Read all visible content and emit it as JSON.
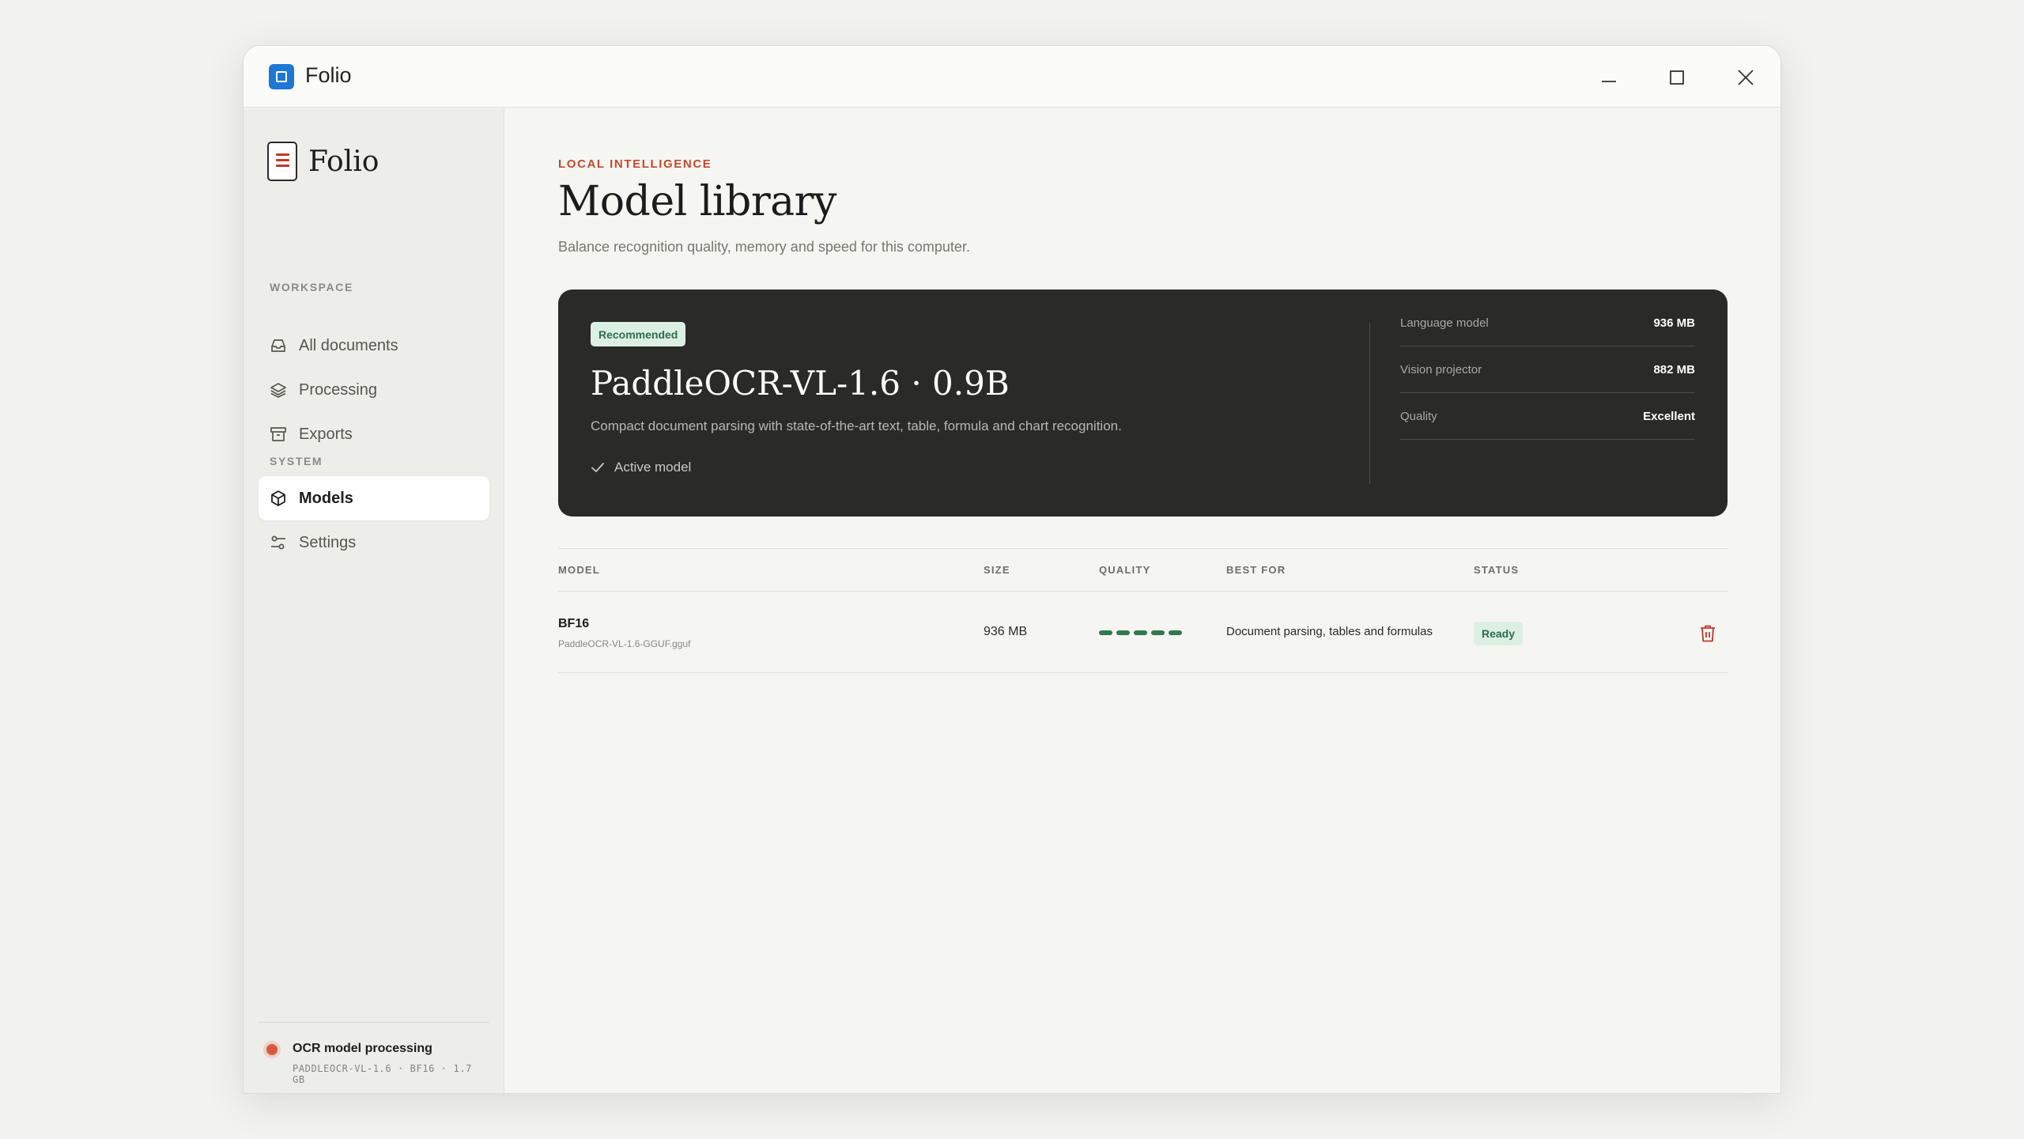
{
  "window": {
    "title": "Folio",
    "controls": [
      "minimize",
      "maximize",
      "close"
    ]
  },
  "sidebar": {
    "brand": "Folio",
    "workspace_label": "WORKSPACE",
    "workspace_items": [
      {
        "label": "All documents",
        "icon": "inbox-icon"
      },
      {
        "label": "Processing",
        "icon": "layers-icon"
      },
      {
        "label": "Exports",
        "icon": "archive-icon"
      }
    ],
    "system_label": "SYSTEM",
    "system_items": [
      {
        "label": "Models",
        "icon": "cube-icon",
        "active": true
      },
      {
        "label": "Settings",
        "icon": "sliders-icon"
      }
    ],
    "footer": {
      "title": "OCR model processing",
      "subtitle": "PADDLEOCR-VL-1.6 · BF16 · 1.7 GB"
    }
  },
  "main": {
    "eyebrow": "LOCAL INTELLIGENCE",
    "title": "Model library",
    "subtitle": "Balance recognition quality, memory and speed for this computer.",
    "hero": {
      "badge": "Recommended",
      "title": "PaddleOCR-VL-1.6 · 0.9B",
      "description": "Compact document parsing with state-of-the-art text, table, formula and chart recognition.",
      "active_label": "Active model",
      "specs": [
        {
          "key": "Language model",
          "value": "936 MB"
        },
        {
          "key": "Vision projector",
          "value": "882 MB"
        },
        {
          "key": "Quality",
          "value": "Excellent"
        }
      ]
    },
    "table": {
      "headers": {
        "model": "MODEL",
        "size": "SIZE",
        "quality": "QUALITY",
        "best_for": "BEST FOR",
        "status": "STATUS"
      },
      "rows": [
        {
          "name": "BF16",
          "file": "PaddleOCR-VL-1.6-GGUF.gguf",
          "size": "936 MB",
          "quality": 5,
          "quality_max": 5,
          "best_for": "Document parsing, tables and formulas",
          "status": "Ready"
        }
      ]
    }
  },
  "colors": {
    "accent": "#c44a2c",
    "app_icon": "#1d78d3",
    "hero_bg": "#2a2a28",
    "ready_bg": "#dcefe3",
    "ready_text": "#2c6e49",
    "quality_bar": "#2f7a4f",
    "delete_icon": "#c0392b"
  }
}
